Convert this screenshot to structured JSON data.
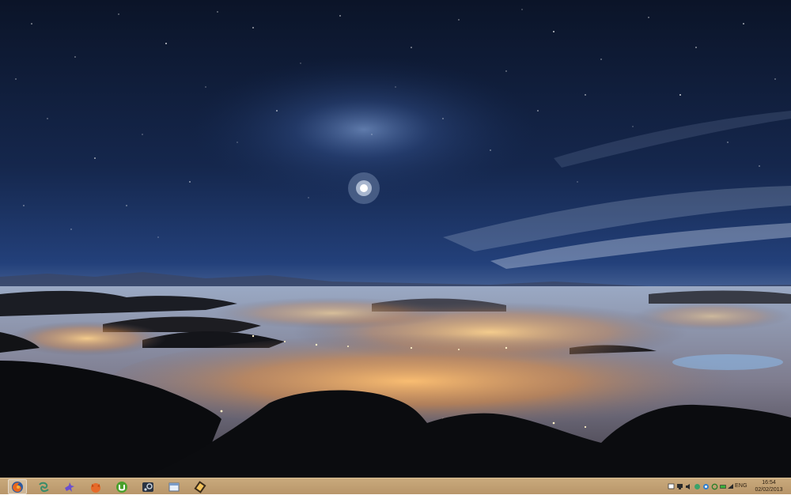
{
  "wallpaper": {
    "name": "night-sky-over-foggy-valley",
    "colors": {
      "sky_top": "#0b1428",
      "sky_mid": "#1c3566",
      "horizon": "#6f86ad",
      "fog_glow": "#f0a656",
      "hills": "#0a0c10"
    }
  },
  "taskbar": {
    "color": "#c4a373",
    "pinned": [
      {
        "name": "firefox",
        "icon": "firefox-icon",
        "active": true
      },
      {
        "name": "app-2",
        "icon": "swirl-icon",
        "active": false
      },
      {
        "name": "app-3",
        "icon": "bird-icon",
        "active": false
      },
      {
        "name": "app-4",
        "icon": "fox-icon",
        "active": false
      },
      {
        "name": "utorrent",
        "icon": "utorrent-icon",
        "active": false
      },
      {
        "name": "steam",
        "icon": "steam-icon",
        "active": false
      },
      {
        "name": "window-app",
        "icon": "window-icon",
        "active": false
      },
      {
        "name": "media-app",
        "icon": "film-icon",
        "active": false
      }
    ]
  },
  "tray": {
    "icons": [
      "flag-icon",
      "monitor-icon",
      "speaker-icon",
      "network-icon",
      "shield-icon",
      "refresh-icon",
      "battery-icon",
      "wifi-icon"
    ],
    "language": "ENG",
    "time": "16:54",
    "date": "02/02/2013"
  }
}
